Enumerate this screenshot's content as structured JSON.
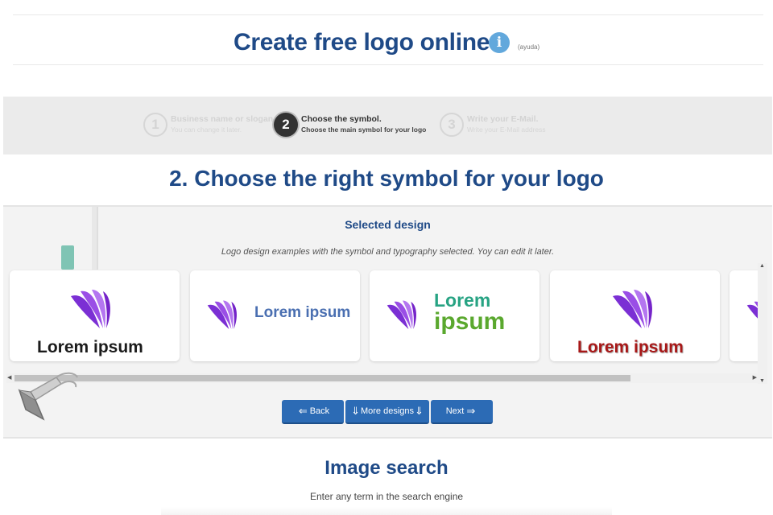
{
  "header": {
    "title": "Create free logo online",
    "info_icon": "info-icon",
    "help_label": "(ayuda)"
  },
  "steps": [
    {
      "number": "1",
      "title": "Business name or slogan",
      "subtitle": "You can change it later.",
      "active": false
    },
    {
      "number": "2",
      "title": "Choose the symbol.",
      "subtitle": "Choose the main symbol for your logo",
      "active": true
    },
    {
      "number": "3",
      "title": "Write your E-Mail.",
      "subtitle": "Write your E-Mail address",
      "active": false
    }
  ],
  "section_heading": "2. Choose the right symbol for your logo",
  "selected_design": {
    "title": "Selected design",
    "subtitle": "Logo design examples with the symbol and typography selected. Yoy can edit it later."
  },
  "logo_cards": [
    {
      "text": "Lorem ipsum",
      "layout": "stacked",
      "text_color": "#1b1b1b"
    },
    {
      "text": "Lorem ipsum",
      "layout": "inline",
      "text_color": "#4a6fb1"
    },
    {
      "text_line1": "Lorem",
      "text_line2": "ipsum",
      "layout": "inline-two-line",
      "line1_color": "#27a383",
      "line2_color": "#5aa82e"
    },
    {
      "text": "Lorem ipsum",
      "layout": "stacked",
      "text_color": "#a81818"
    }
  ],
  "symbol_color": "#8a2be2",
  "buttons": {
    "back": "Back",
    "more_designs": "More designs",
    "next": "Next"
  },
  "image_search": {
    "title": "Image search",
    "subtitle": "Enter any term in the search engine"
  },
  "colors": {
    "brand_blue": "#1f4a87",
    "button_blue": "#2c6bb5",
    "info_blue": "#62a8dc"
  }
}
